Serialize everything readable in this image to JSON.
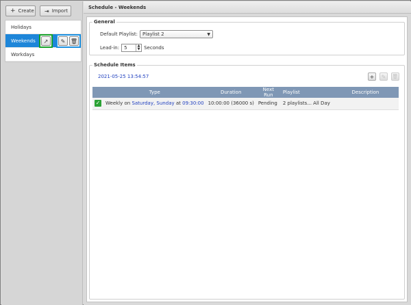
{
  "left": {
    "toolbar": {
      "create_label": "Create",
      "import_label": "Import"
    },
    "items": [
      {
        "label": "Holidays"
      },
      {
        "label": "Weekends"
      },
      {
        "label": "Workdays"
      }
    ]
  },
  "right": {
    "title": "Schedule - Weekends",
    "general": {
      "legend": "General",
      "default_playlist_label": "Default Playlist:",
      "default_playlist_value": "Playlist 2",
      "lead_in_label": "Lead-in:",
      "lead_in_value": "5",
      "lead_in_unit": "Seconds"
    },
    "schedule_items": {
      "legend": "Schedule Items",
      "datetime": "2021-05-25 13:54:57",
      "columns": [
        "",
        "Type",
        "Duration",
        "Next Run",
        "Playlist",
        "Description"
      ],
      "rows": [
        {
          "type_prefix": "Weekly on ",
          "type_days": "Saturday, Sunday",
          "type_mid": " at ",
          "type_time": "09:30:00",
          "duration": "10:00:00 (36000 s)",
          "next_run": "Pending",
          "playlist": "2 playlists... All Day",
          "description": ""
        }
      ]
    }
  },
  "colors": {
    "selected": "#1e86d9",
    "header": "#7f97b5",
    "pending": "#e12727",
    "link": "#1f3fbf",
    "highlight_green": "#17a22a",
    "highlight_blue": "#1a8fe0"
  }
}
